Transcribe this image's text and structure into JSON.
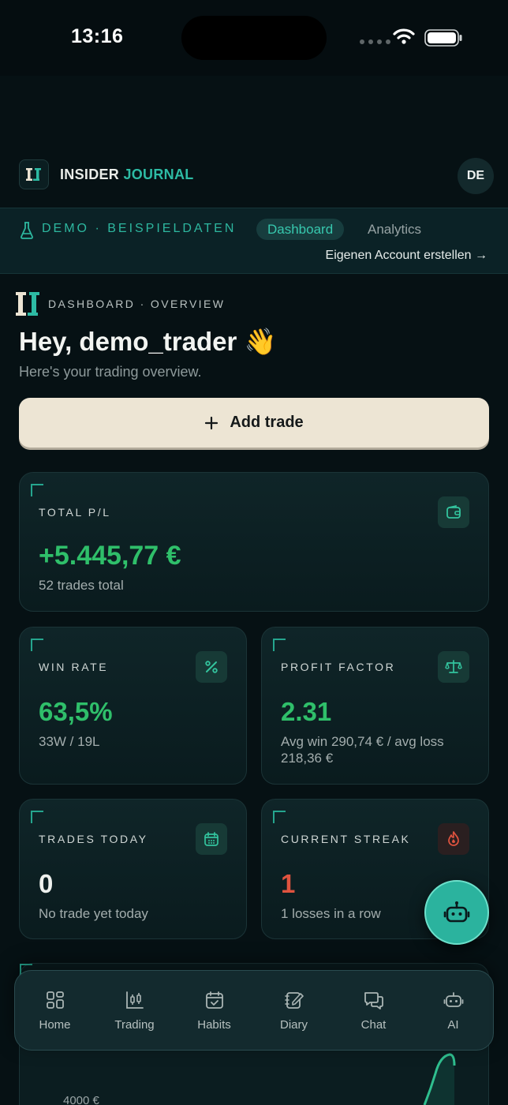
{
  "status_bar": {
    "time": "13:16"
  },
  "header": {
    "brand_part1": "INSIDER",
    "brand_part2": "JOURNAL",
    "language": "DE"
  },
  "demo_banner": {
    "label": "DEMO · BEISPIELDATEN",
    "tabs": [
      {
        "label": "Dashboard",
        "active": true
      },
      {
        "label": "Analytics",
        "active": false
      }
    ],
    "create_account": "Eigenen Account erstellen →"
  },
  "page": {
    "eyebrow": "DASHBOARD · OVERVIEW",
    "greeting": "Hey, demo_trader 👋",
    "subtitle": "Here's your trading overview."
  },
  "add_trade": {
    "icon": "plus-icon",
    "label": "Add trade"
  },
  "stats": {
    "total_pl": {
      "label": "TOTAL P/L",
      "value": "+5.445,77 €",
      "sub": "52 trades total",
      "icon": "wallet-icon"
    },
    "win_rate": {
      "label": "WIN RATE",
      "value": "63,5%",
      "sub": "33W / 19L",
      "icon": "percent-icon"
    },
    "profit_factor": {
      "label": "PROFIT FACTOR",
      "value": "2.31",
      "sub": "Avg win 290,74 € / avg loss 218,36 €",
      "icon": "scale-icon"
    },
    "trades_today": {
      "label": "TRADES TODAY",
      "value": "0",
      "sub": "No trade yet today",
      "icon": "calendar-icon"
    },
    "current_streak": {
      "label": "CURRENT STREAK",
      "value": "1",
      "sub": "1 losses in a row",
      "icon": "flame-icon"
    }
  },
  "chart_preview": {
    "y_tick": "4000 €"
  },
  "nav": [
    {
      "label": "Home",
      "icon": "grid-icon"
    },
    {
      "label": "Trading",
      "icon": "candlestick-icon"
    },
    {
      "label": "Habits",
      "icon": "calendar-check-icon"
    },
    {
      "label": "Diary",
      "icon": "notebook-icon"
    },
    {
      "label": "Chat",
      "icon": "chat-icon"
    },
    {
      "label": "AI",
      "icon": "robot-icon"
    }
  ],
  "colors": {
    "accent": "#2bb39e",
    "positive": "#2fbf6a",
    "negative": "#e0533f",
    "background": "#061114",
    "cta": "#ede5d4"
  }
}
